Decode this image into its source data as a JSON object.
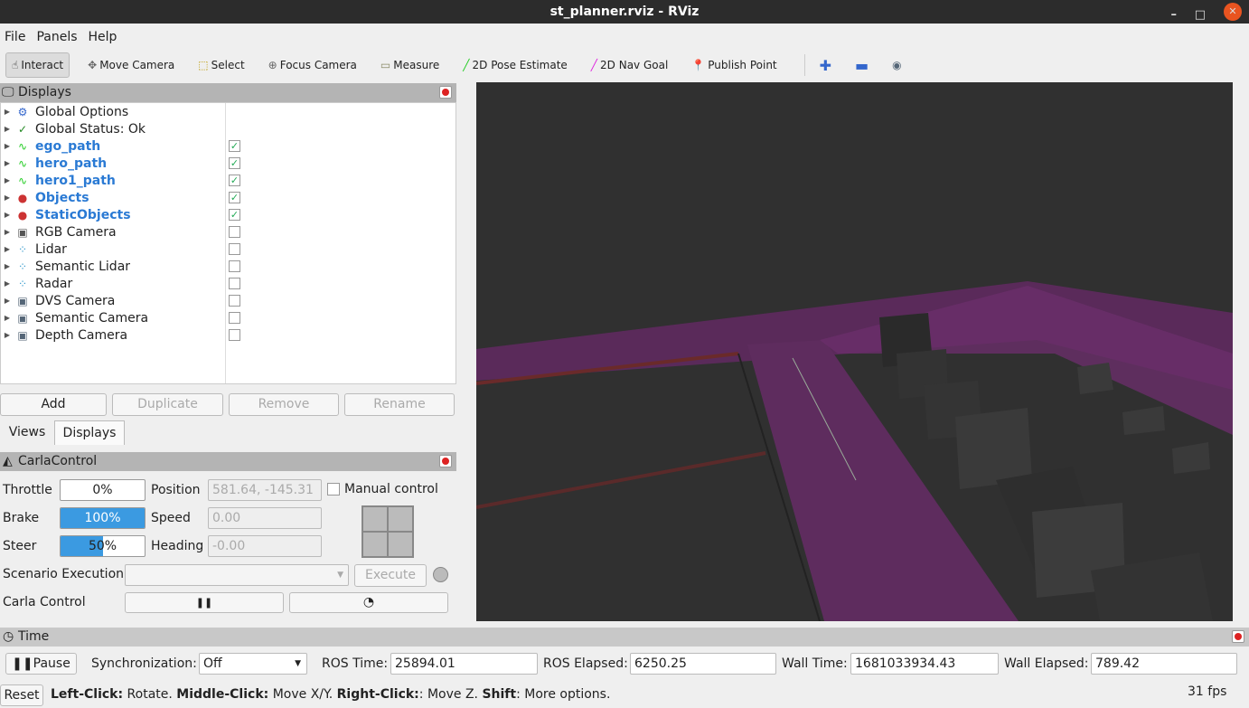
{
  "window": {
    "title": "st_planner.rviz - RViz",
    "minimize": "–",
    "maximize": "□",
    "close": "✕"
  },
  "menu": [
    "File",
    "Panels",
    "Help"
  ],
  "toolbar": [
    {
      "label": "Interact",
      "icon": "hand-icon",
      "glyph": "☝",
      "color": "#333"
    },
    {
      "label": "Move Camera",
      "icon": "move-camera-icon",
      "glyph": "✥",
      "color": "#666"
    },
    {
      "label": "Select",
      "icon": "select-icon",
      "glyph": "⬚",
      "color": "#b90"
    },
    {
      "label": "Focus Camera",
      "icon": "focus-camera-icon",
      "glyph": "⊕",
      "color": "#666"
    },
    {
      "label": "Measure",
      "icon": "ruler-icon",
      "glyph": "▭",
      "color": "#886"
    },
    {
      "label": "2D Pose Estimate",
      "icon": "pose-arrow-icon",
      "glyph": "╱",
      "color": "#2c2"
    },
    {
      "label": "2D Nav Goal",
      "icon": "nav-goal-arrow-icon",
      "glyph": "╱",
      "color": "#d2d"
    },
    {
      "label": "Publish Point",
      "icon": "map-pin-icon",
      "glyph": "📍",
      "color": "#c42"
    }
  ],
  "displays": {
    "title": "Displays",
    "items": [
      {
        "label": "Global Options",
        "icon": "gear-icon",
        "glyph": "⚙",
        "color": "#36c",
        "bold": false
      },
      {
        "label": "Global Status: Ok",
        "icon": "check-icon",
        "glyph": "✓",
        "color": "#282",
        "bold": false
      },
      {
        "label": "ego_path",
        "icon": "path-icon",
        "glyph": "∿",
        "color": "#2c2",
        "bold": true,
        "checked": true
      },
      {
        "label": "hero_path",
        "icon": "path-icon",
        "glyph": "∿",
        "color": "#2c2",
        "bold": true,
        "checked": true
      },
      {
        "label": "hero1_path",
        "icon": "path-icon",
        "glyph": "∿",
        "color": "#2c2",
        "bold": true,
        "checked": true
      },
      {
        "label": "Objects",
        "icon": "markers-icon",
        "glyph": "●",
        "color": "#c33",
        "bold": true,
        "checked": true
      },
      {
        "label": "StaticObjects",
        "icon": "markers-icon",
        "glyph": "●",
        "color": "#c33",
        "bold": true,
        "checked": true
      },
      {
        "label": "RGB Camera",
        "icon": "camera-icon",
        "glyph": "▣",
        "color": "#555",
        "bold": false,
        "checked": false
      },
      {
        "label": "Lidar",
        "icon": "pointcloud-icon",
        "glyph": "⁘",
        "color": "#39c",
        "bold": false,
        "checked": false
      },
      {
        "label": "Semantic Lidar",
        "icon": "pointcloud-icon",
        "glyph": "⁘",
        "color": "#39c",
        "bold": false,
        "checked": false
      },
      {
        "label": "Radar",
        "icon": "pointcloud-icon",
        "glyph": "⁘",
        "color": "#39c",
        "bold": false,
        "checked": false
      },
      {
        "label": "DVS Camera",
        "icon": "image-icon",
        "glyph": "▣",
        "color": "#567",
        "bold": false,
        "checked": false
      },
      {
        "label": "Semantic Camera",
        "icon": "image-icon",
        "glyph": "▣",
        "color": "#567",
        "bold": false,
        "checked": false
      },
      {
        "label": "Depth Camera",
        "icon": "image-icon",
        "glyph": "▣",
        "color": "#567",
        "bold": false,
        "checked": false
      }
    ],
    "buttons": {
      "add": "Add",
      "duplicate": "Duplicate",
      "remove": "Remove",
      "rename": "Rename"
    }
  },
  "tabs": {
    "views": "Views",
    "displays": "Displays"
  },
  "carla": {
    "title": "CarlaControl",
    "throttle_label": "Throttle",
    "throttle": 0,
    "throttle_text": "0%",
    "brake_label": "Brake",
    "brake": 100,
    "brake_text": "100%",
    "steer_label": "Steer",
    "steer": 50,
    "steer_text": "50%",
    "position_label": "Position",
    "position": "581.64, -145.31",
    "speed_label": "Speed",
    "speed": "0.00",
    "heading_label": "Heading",
    "heading": "-0.00",
    "manual_label": "Manual control",
    "manual": false,
    "scenario_label": "Scenario Execution",
    "scenario_value": "",
    "execute": "Execute",
    "control_label": "Carla Control",
    "pause_glyph": "❚❚",
    "step_glyph": "◔"
  },
  "time": {
    "title": "Time",
    "pause": "Pause",
    "sync_label": "Synchronization:",
    "sync_value": "Off",
    "ros_time_label": "ROS Time:",
    "ros_time": "25894.01",
    "ros_elapsed_label": "ROS Elapsed:",
    "ros_elapsed": "6250.25",
    "wall_time_label": "Wall Time:",
    "wall_time": "1681033934.43",
    "wall_elapsed_label": "Wall Elapsed:",
    "wall_elapsed": "789.42"
  },
  "status": {
    "reset": "Reset",
    "parts": [
      [
        "Left-Click:",
        " Rotate. "
      ],
      [
        "Middle-Click:",
        " Move X/Y. "
      ],
      [
        "Right-Click:",
        ": Move Z. "
      ],
      [
        "Shift",
        ": More options."
      ]
    ],
    "fps": "31 fps"
  },
  "colors": {
    "road": "#7a2a7a",
    "accent": "#3b9ae1"
  }
}
